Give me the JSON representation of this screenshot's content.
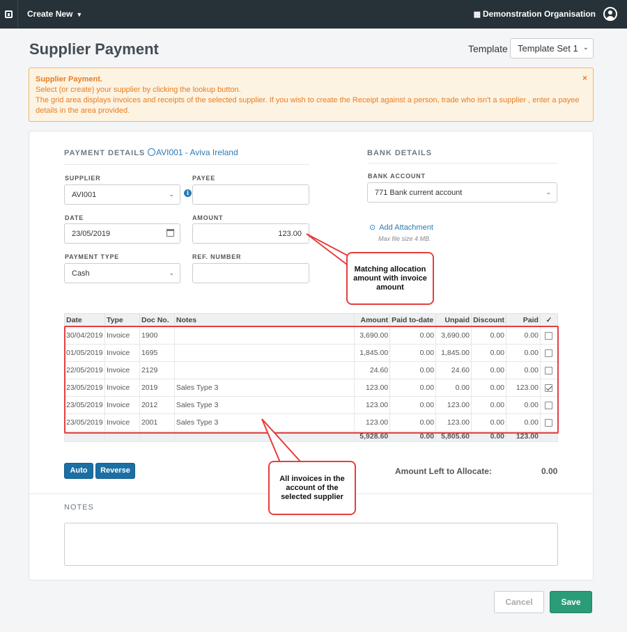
{
  "topbar": {
    "create_new": "Create New",
    "organisation": "Demonstration Organisation"
  },
  "page": {
    "title": "Supplier Payment",
    "template_label": "Template",
    "template_value": "Template Set 1"
  },
  "alert": {
    "title": "Supplier Payment.",
    "line1": "Select (or create) your supplier by clicking the lookup button.",
    "line2": "The grid area displays invoices and receipts of the selected supplier. If you wish to create the Receipt against a person, trade who isn't a supplier , enter a payee details in the area provided.",
    "close": "×"
  },
  "payment": {
    "heading": "PAYMENT DETAILS",
    "supplier_link": "AVI001 - Aviva Ireland",
    "supplier_label": "SUPPLIER",
    "supplier_value": "AVI001",
    "payee_label": "PAYEE",
    "payee_value": "",
    "date_label": "DATE",
    "date_value": "23/05/2019",
    "amount_label": "AMOUNT",
    "amount_value": "123.00",
    "type_label": "PAYMENT TYPE",
    "type_value": "Cash",
    "ref_label": "REF. NUMBER",
    "ref_value": ""
  },
  "bank": {
    "heading": "BANK DETAILS",
    "account_label": "BANK ACCOUNT",
    "account_value": "771 Bank current account",
    "attach_label": "Add Attachment",
    "max_size": "Max file size 4 MB."
  },
  "grid": {
    "columns": [
      "Date",
      "Type",
      "Doc No.",
      "Notes",
      "Amount",
      "Paid to-date",
      "Unpaid",
      "Discount",
      "Paid",
      "✓"
    ],
    "rows": [
      {
        "date": "30/04/2019",
        "type": "Invoice",
        "doc": "1900",
        "notes": "",
        "amount": "3,690.00",
        "paid_to_date": "0.00",
        "unpaid": "3,690.00",
        "discount": "0.00",
        "paid": "0.00",
        "checked": false
      },
      {
        "date": "01/05/2019",
        "type": "Invoice",
        "doc": "1695",
        "notes": "",
        "amount": "1,845.00",
        "paid_to_date": "0.00",
        "unpaid": "1,845.00",
        "discount": "0.00",
        "paid": "0.00",
        "checked": false
      },
      {
        "date": "22/05/2019",
        "type": "Invoice",
        "doc": "2129",
        "notes": "",
        "amount": "24.60",
        "paid_to_date": "0.00",
        "unpaid": "24.60",
        "discount": "0.00",
        "paid": "0.00",
        "checked": false
      },
      {
        "date": "23/05/2019",
        "type": "Invoice",
        "doc": "2019",
        "notes": "Sales Type 3",
        "amount": "123.00",
        "paid_to_date": "0.00",
        "unpaid": "0.00",
        "discount": "0.00",
        "paid": "123.00",
        "checked": true
      },
      {
        "date": "23/05/2019",
        "type": "Invoice",
        "doc": "2012",
        "notes": "Sales Type 3",
        "amount": "123.00",
        "paid_to_date": "0.00",
        "unpaid": "123.00",
        "discount": "0.00",
        "paid": "0.00",
        "checked": false
      },
      {
        "date": "23/05/2019",
        "type": "Invoice",
        "doc": "2001",
        "notes": "Sales Type 3",
        "amount": "123.00",
        "paid_to_date": "0.00",
        "unpaid": "123.00",
        "discount": "0.00",
        "paid": "0.00",
        "checked": false
      }
    ],
    "totals": {
      "amount": "5,928.60",
      "paid_to_date": "0.00",
      "unpaid": "5,805.60",
      "discount": "0.00",
      "paid": "123.00"
    }
  },
  "actions": {
    "auto": "Auto",
    "reverse": "Reverse",
    "left_label": "Amount Left to Allocate:",
    "left_value": "0.00"
  },
  "notes": {
    "heading": "NOTES",
    "value": ""
  },
  "footer": {
    "cancel": "Cancel",
    "save": "Save"
  },
  "callouts": {
    "amount": "Matching allocation amount with invoice amount",
    "grid": "All invoices in the account of the selected supplier"
  },
  "colors": {
    "topbar": "#263238",
    "link": "#2a7bb5",
    "primary": "#1b6fa4",
    "save": "#2a9c78",
    "alert": "#e67e22",
    "annotation": "#e53e3e"
  }
}
